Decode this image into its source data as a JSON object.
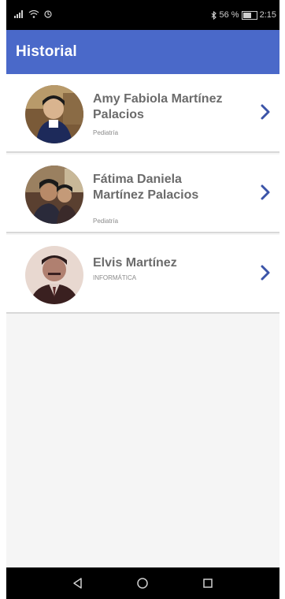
{
  "status_bar": {
    "left_icons": [
      "signal-icon",
      "wifi-icon",
      "sync-icon"
    ],
    "bluetooth_icon": "bluetooth-icon",
    "battery_text": "56 %",
    "battery_level": 0.56,
    "time": "2:15"
  },
  "appbar": {
    "title": "Historial",
    "color": "#4a69c9"
  },
  "contacts": [
    {
      "name_line1": "Amy Fabiola Martínez",
      "name_line2": "Palacios",
      "subtitle": "Pediatría"
    },
    {
      "name_line1": "Fátima Daniela",
      "name_line2": "Martínez Palacios",
      "subtitle": "Pediatría"
    },
    {
      "name_line1": "Elvis Martínez",
      "name_line2": "",
      "subtitle": "INFORMÁTICA"
    }
  ],
  "navbar": {
    "buttons": [
      "back-icon",
      "home-icon",
      "recents-icon"
    ]
  },
  "colors": {
    "chevron": "#3b54a8",
    "name": "#6b6b6b"
  }
}
